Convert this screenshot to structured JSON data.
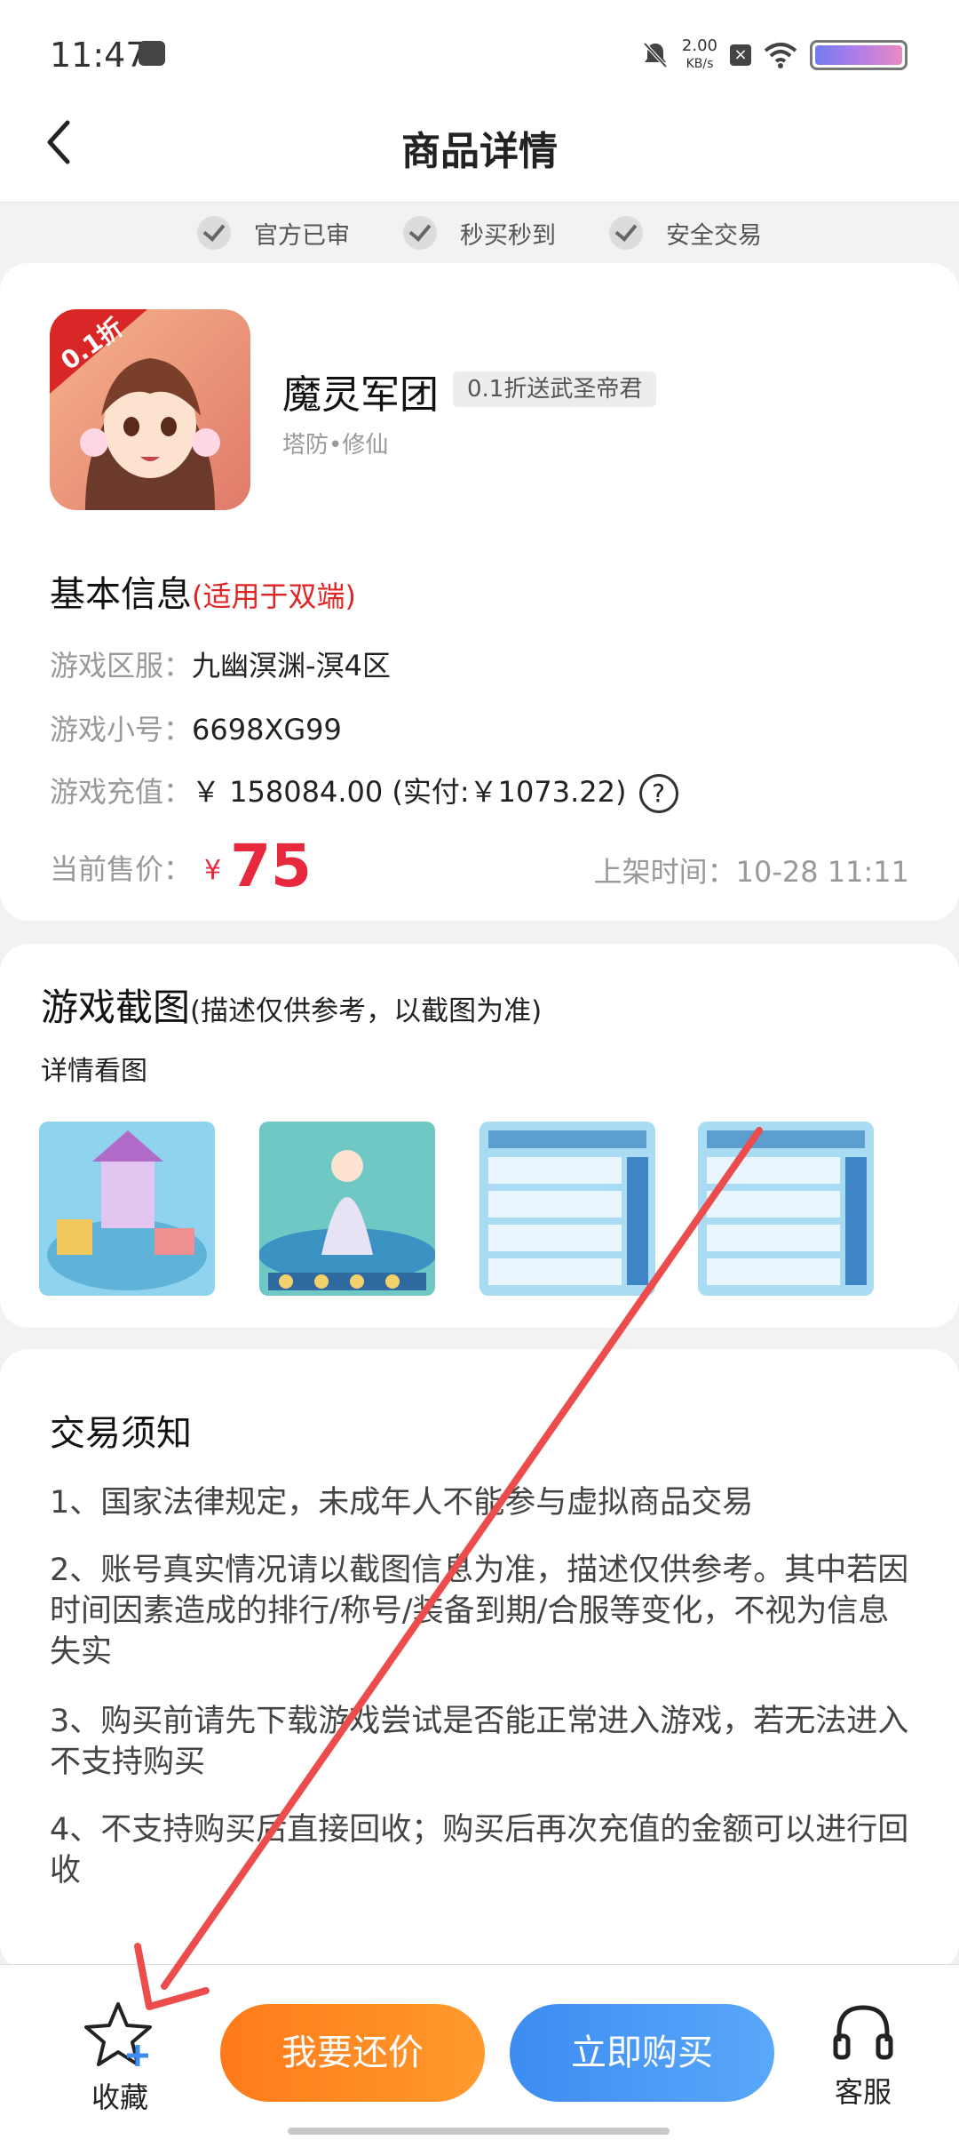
{
  "status_bar": {
    "time": "11:47",
    "net_speed_value": "2.00",
    "net_speed_unit": "KB/s"
  },
  "header": {
    "title": "商品详情"
  },
  "badges": [
    "官方已审",
    "秒买秒到",
    "安全交易"
  ],
  "game": {
    "name": "魔灵军团",
    "tag": "0.1折送武圣帝君",
    "category": "塔防•修仙",
    "icon_label": "0.1折"
  },
  "basic_info": {
    "title": "基本信息",
    "title_note": "(适用于双端)",
    "server_label": "游戏区服：",
    "server_value": "九幽溟渊-溟4区",
    "account_label": "游戏小号：",
    "account_value": "6698XG99",
    "recharge_label": "游戏充值：",
    "recharge_value": "￥ 158084.00 (实付:￥1073.22)",
    "price_label": "当前售价：",
    "price_currency": "¥",
    "price_value": "75",
    "listed_time": "上架时间：10-28 11:11"
  },
  "screenshots": {
    "title": "游戏截图",
    "title_note": "(描述仅供参考，以截图为准)",
    "detail_link": "详情看图"
  },
  "notice": {
    "title": "交易须知",
    "items": [
      "1、国家法律规定，未成年人不能参与虚拟商品交易",
      "2、账号真实情况请以截图信息为准，描述仅供参考。其中若因时间因素造成的排行/称号/装备到期/合服等变化，不视为信息失实",
      "3、购买前请先下载游戏尝试是否能正常进入游戏，若无法进入不支持购买",
      "4、不支持购买后直接回收；购买后再次充值的金额可以进行回收"
    ]
  },
  "bottom_bar": {
    "favorite_label": "收藏",
    "bargain_label": "我要还价",
    "buy_label": "立即购买",
    "service_label": "客服"
  },
  "colors": {
    "accent_red": "#e8283c",
    "orange": "#ff8a22",
    "blue": "#4a9af6",
    "annotation_arrow": "#ec4c4c"
  }
}
